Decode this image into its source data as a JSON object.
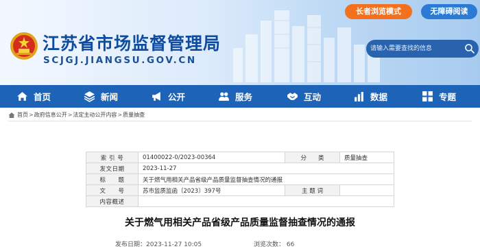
{
  "top_buttons": {
    "elder_mode": "长者浏览模式",
    "accessibility": "无障碍阅读"
  },
  "site": {
    "title": "江苏省市场监督管理局",
    "url": "SCJGJ.JIANGSU.GOV.CN"
  },
  "search": {
    "placeholder": "请输入需要查找的信息"
  },
  "nav": [
    {
      "label": "首页",
      "icon": "home-icon"
    },
    {
      "label": "新闻",
      "icon": "layers-icon"
    },
    {
      "label": "公开",
      "icon": "megaphone-icon"
    },
    {
      "label": "服务",
      "icon": "people-icon"
    },
    {
      "label": "互动",
      "icon": "handshake-icon"
    },
    {
      "label": "数据",
      "icon": "chart-icon"
    },
    {
      "label": "专题",
      "icon": "grid-icon"
    }
  ],
  "breadcrumb": [
    "首页",
    "政府信息公开",
    "法定主动公开内容",
    "质量抽查"
  ],
  "info": {
    "index_label": "索 引 号",
    "index_value": "01400022-0/2023-00364",
    "category_label": "分　　类",
    "category_value": "质量抽查",
    "date_label": "发文日期",
    "date_value": "2023-11-27",
    "title_label": "标　　题",
    "title_value": "关于燃气用相关产品省级产品质量监督抽查情况的通报",
    "docno_label": "文　　号",
    "docno_value": "苏市监质监函〔2023〕397号",
    "topic_label": "主 题 词",
    "topic_value": "",
    "summary_label": "内容概述",
    "summary_value": ""
  },
  "article": {
    "title": "关于燃气用相关产品省级产品质量监督抽查情况的通报",
    "publish_time": "发布日期：2023-11-27 10:05",
    "views": "浏览次数： 66"
  }
}
